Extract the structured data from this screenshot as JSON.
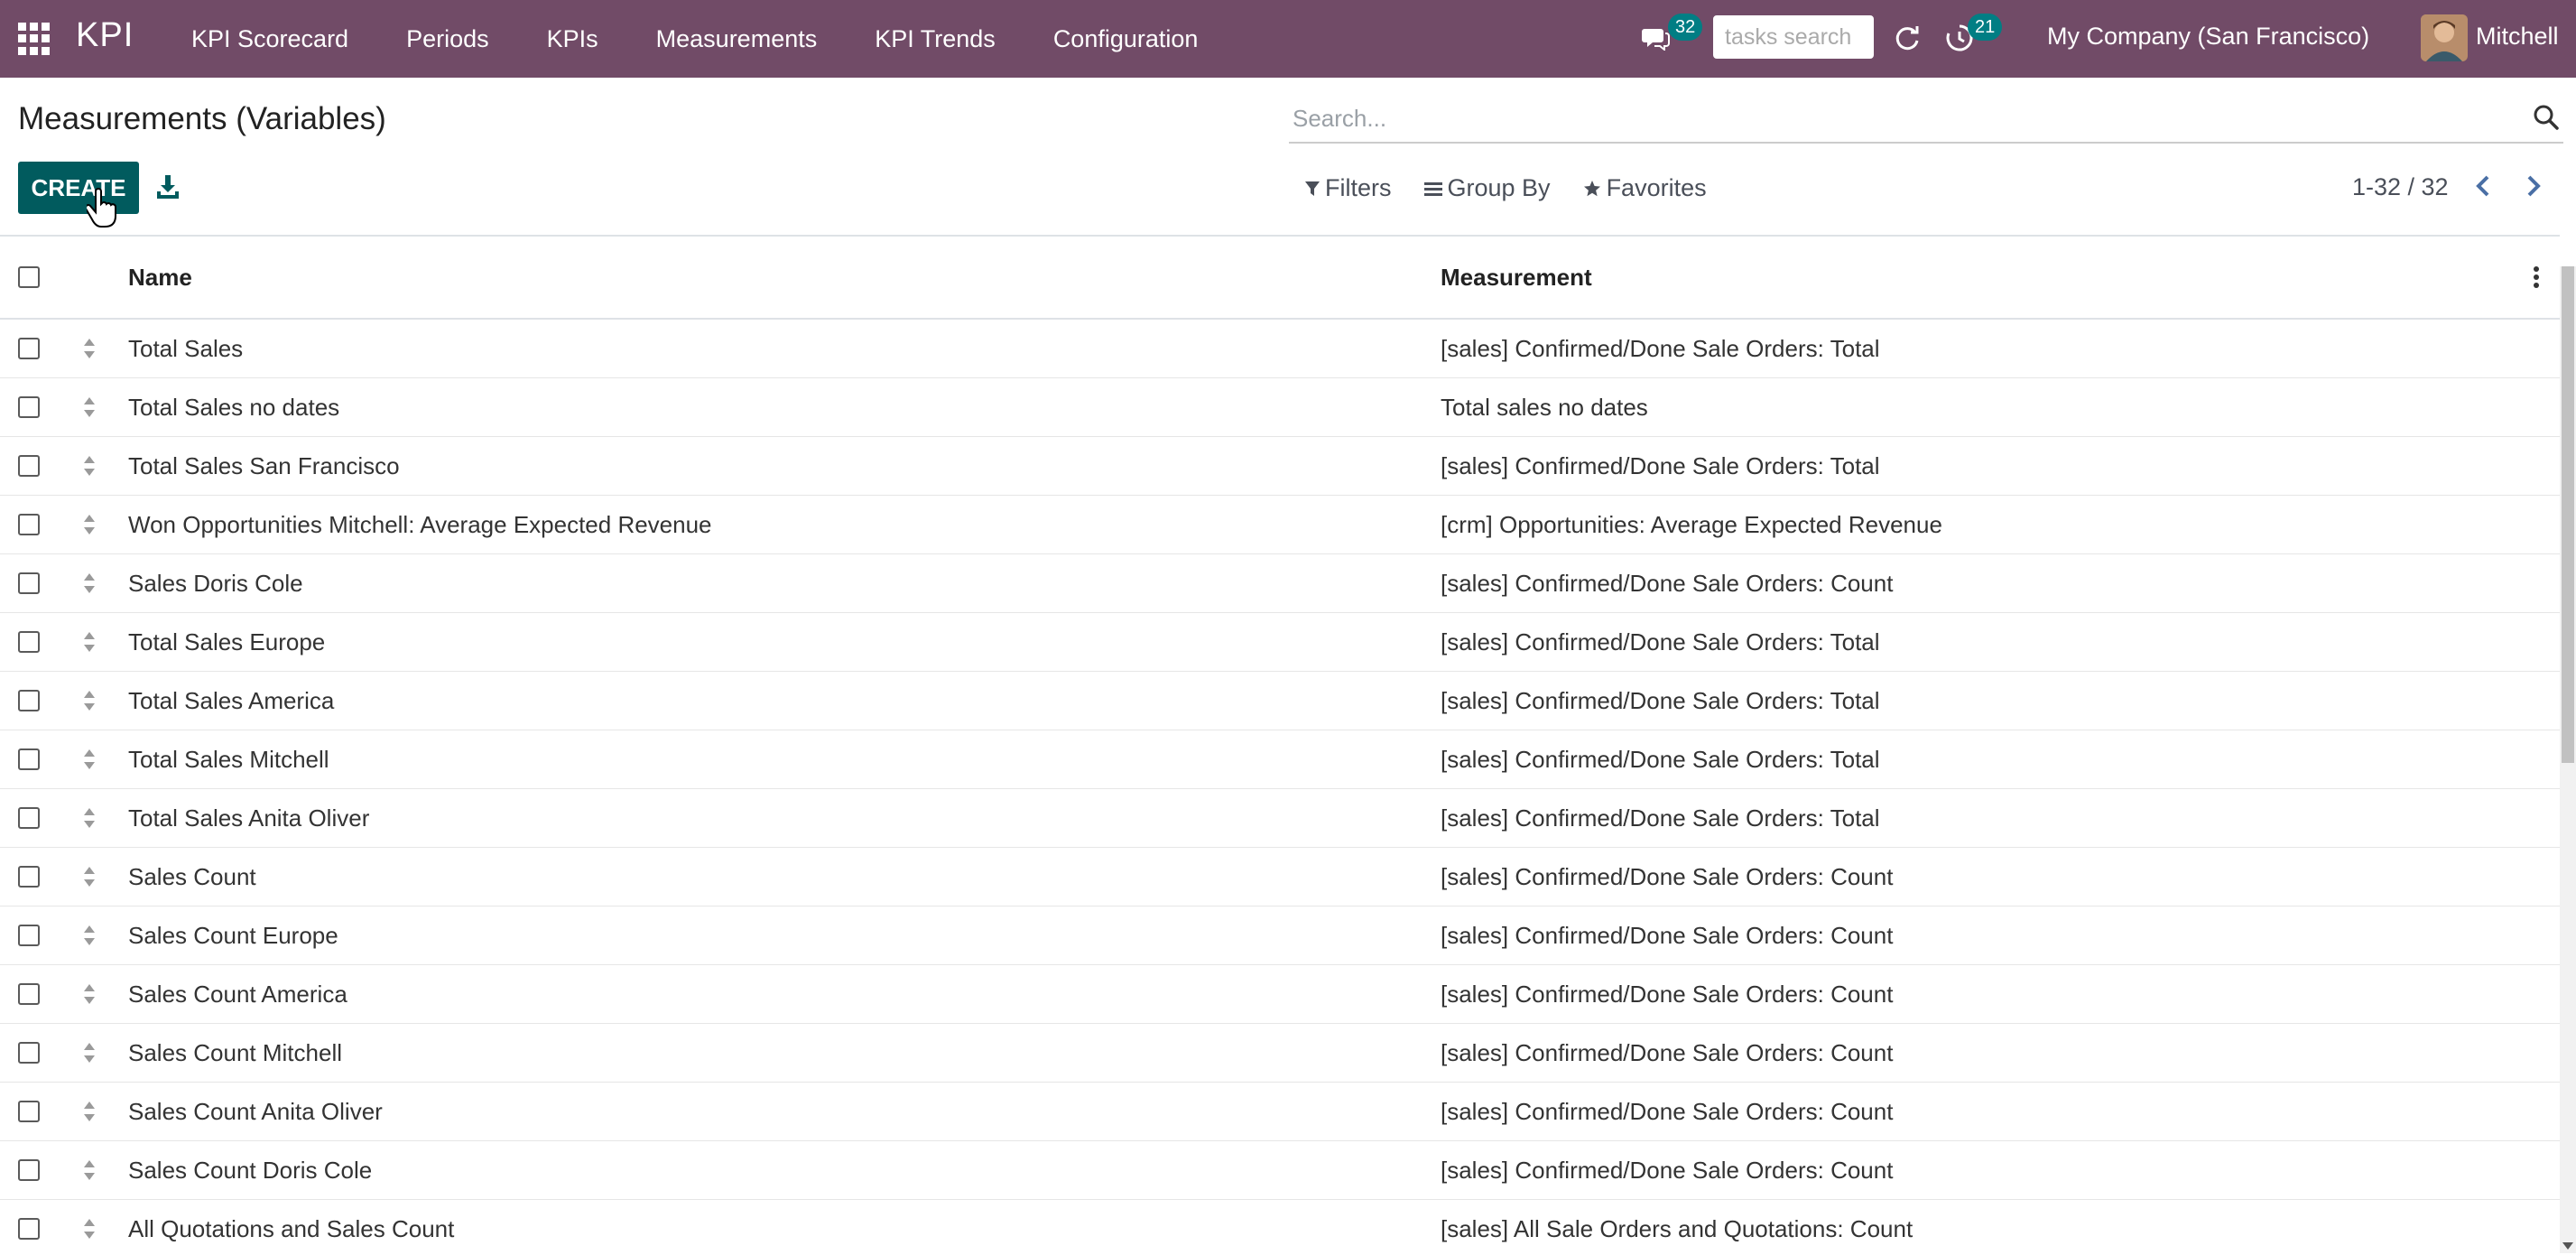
{
  "navbar": {
    "brand": "KPI",
    "menu": [
      "KPI Scorecard",
      "Periods",
      "KPIs",
      "Measurements",
      "KPI Trends",
      "Configuration"
    ],
    "messages_count": "32",
    "tasks_search_placeholder": "tasks search",
    "activities_count": "21",
    "company": "My Company (San Francisco)",
    "user": "Mitchell"
  },
  "control": {
    "title": "Measurements (Variables)",
    "search_placeholder": "Search...",
    "create_label": "CREATE",
    "filters_label": "Filters",
    "groupby_label": "Group By",
    "favorites_label": "Favorites",
    "pager": "1-32 / 32"
  },
  "table": {
    "columns": [
      "Name",
      "Measurement"
    ],
    "rows": [
      {
        "name": "Total Sales",
        "measurement": "[sales] Confirmed/Done Sale Orders: Total"
      },
      {
        "name": "Total Sales no dates",
        "measurement": "Total sales no dates"
      },
      {
        "name": "Total Sales San Francisco",
        "measurement": "[sales] Confirmed/Done Sale Orders: Total"
      },
      {
        "name": "Won Opportunities Mitchell: Average Expected Revenue",
        "measurement": "[crm] Opportunities: Average Expected Revenue"
      },
      {
        "name": "Sales Doris Cole",
        "measurement": "[sales] Confirmed/Done Sale Orders: Count"
      },
      {
        "name": "Total Sales Europe",
        "measurement": "[sales] Confirmed/Done Sale Orders: Total"
      },
      {
        "name": "Total Sales America",
        "measurement": "[sales] Confirmed/Done Sale Orders: Total"
      },
      {
        "name": "Total Sales Mitchell",
        "measurement": "[sales] Confirmed/Done Sale Orders: Total"
      },
      {
        "name": "Total Sales Anita Oliver",
        "measurement": "[sales] Confirmed/Done Sale Orders: Total"
      },
      {
        "name": "Sales Count",
        "measurement": "[sales] Confirmed/Done Sale Orders: Count"
      },
      {
        "name": "Sales Count Europe",
        "measurement": "[sales] Confirmed/Done Sale Orders: Count"
      },
      {
        "name": "Sales Count America",
        "measurement": "[sales] Confirmed/Done Sale Orders: Count"
      },
      {
        "name": "Sales Count Mitchell",
        "measurement": "[sales] Confirmed/Done Sale Orders: Count"
      },
      {
        "name": "Sales Count Anita Oliver",
        "measurement": "[sales] Confirmed/Done Sale Orders: Count"
      },
      {
        "name": "Sales Count Doris Cole",
        "measurement": "[sales] Confirmed/Done Sale Orders: Count"
      },
      {
        "name": "All Quotations and Sales Count",
        "measurement": "[sales] All Sale Orders and Quotations: Count"
      }
    ]
  },
  "colors": {
    "navbar": "#714b67",
    "primary_button": "#015b5e",
    "badge": "#017e84"
  }
}
